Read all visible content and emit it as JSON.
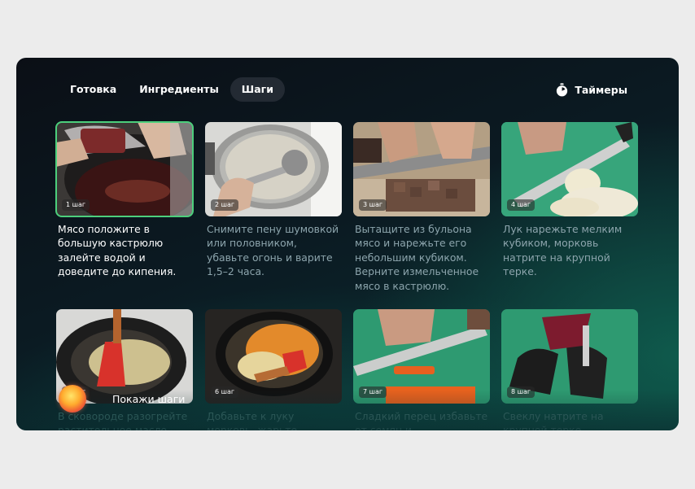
{
  "tabs": [
    {
      "label": "Готовка",
      "active": false
    },
    {
      "label": "Ингредиенты",
      "active": false
    },
    {
      "label": "Шаги",
      "active": true
    }
  ],
  "timers": {
    "label": "Таймеры",
    "icon": "stopwatch-icon"
  },
  "steps": [
    {
      "badge": "1 шаг",
      "text": "Мясо положите в большую кастрюлю залейте водой и доведите до кипения.",
      "selected": true
    },
    {
      "badge": "2 шаг",
      "text": "Снимите пену шумовкой или половником, убавьте огонь и варите 1,5–2 часа."
    },
    {
      "badge": "3 шаг",
      "text": "Вытащите из бульона мясо и нарежьте его небольшим кубиком. Верните измельченное мясо в кастрюлю."
    },
    {
      "badge": "4 шаг",
      "text": "Лук нарежьте мелким кубиком, морковь натрите на крупной терке."
    },
    {
      "badge": "5 шаг",
      "text": "В сковороде разогрейте растительное масло"
    },
    {
      "badge": "6 шаг",
      "text": "Добавьте к луку морковь, жарьте"
    },
    {
      "badge": "7 шаг",
      "text": "Сладкий перец избавьте от семян и"
    },
    {
      "badge": "8 шаг",
      "text": "Свеклу натрите на крупной терке."
    }
  ],
  "assistant": {
    "label": "Покажи шаги"
  },
  "colors": {
    "accent_green": "#4ccf7c",
    "tab_active_bg": "#232a33"
  }
}
